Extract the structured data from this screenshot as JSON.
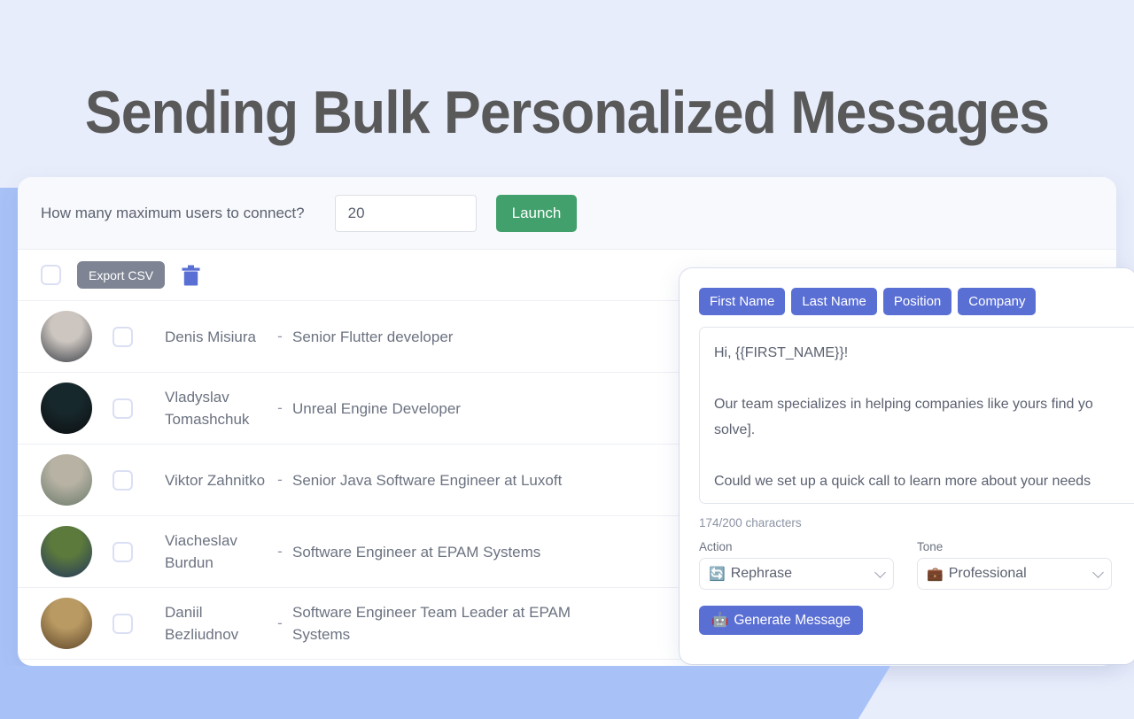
{
  "page": {
    "headline": "Sending Bulk Personalized Messages",
    "background_color": "#e8edfb",
    "accent_blue": "#a8c2f7"
  },
  "toolbar": {
    "question_label": "How many maximum users to connect?",
    "count_value": "20",
    "count_placeholder": "20",
    "launch_label": "Launch",
    "launch_color": "#41a06c"
  },
  "list_header": {
    "export_label": "Export CSV",
    "export_color": "#7e8493",
    "trash_icon": "trash-icon",
    "trash_color": "#5a6fd4",
    "select_all_checked": false
  },
  "rows": [
    {
      "name": "Denis Misiura",
      "separator": "-",
      "title": "Senior Flutter developer",
      "avatar_colors": [
        "#cdc6c0",
        "#3a3f47"
      ]
    },
    {
      "name": "Vladyslav Tomashchuk",
      "separator": "-",
      "title": "Unreal Engine Developer",
      "avatar_colors": [
        "#17282c",
        "#0c0d10"
      ]
    },
    {
      "name": "Viktor Zahnitko",
      "separator": "-",
      "title": "Senior Java Software Engineer at Luxoft",
      "avatar_colors": [
        "#b7b2a4",
        "#6a7a6a"
      ]
    },
    {
      "name": "Viacheslav Burdun",
      "separator": "-",
      "title": "Software Engineer at EPAM Systems",
      "avatar_colors": [
        "#5c7a3c",
        "#23365c"
      ]
    },
    {
      "name": "Daniil Bezliudnov",
      "separator": "-",
      "title": "Software Engineer Team Leader at EPAM Systems",
      "avatar_colors": [
        "#b99a63",
        "#5d4428"
      ]
    }
  ],
  "composer": {
    "tags": [
      {
        "label": "First Name"
      },
      {
        "label": "Last Name"
      },
      {
        "label": "Position"
      },
      {
        "label": "Company"
      }
    ],
    "tag_color": "#5a6fd4",
    "message_text": "Hi, {{FIRST_NAME}}!\n\nOur team specializes in helping companies like yours find yo\nsolve].\n\nCould we set up a quick call to learn more about your needs",
    "char_count": "174/200 characters",
    "action": {
      "label": "Action",
      "value": "Rephrase",
      "emoji": "🔄"
    },
    "tone": {
      "label": "Tone",
      "value": "Professional",
      "emoji": "💼"
    },
    "generate": {
      "label": "Generate Message",
      "emoji": "🤖",
      "color": "#5a6fd4"
    }
  }
}
